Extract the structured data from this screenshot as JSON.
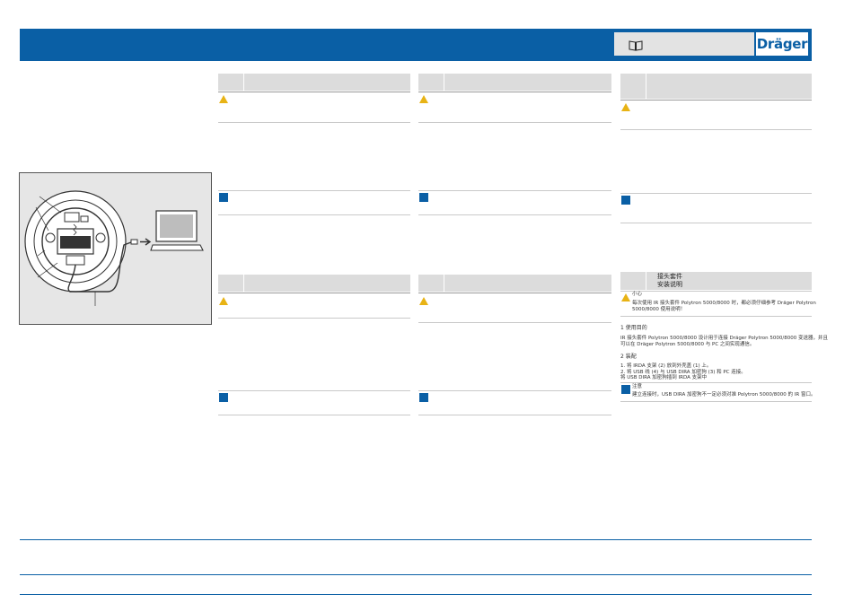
{
  "header": {
    "brand": "Dräger",
    "book_icon": "open-book-icon",
    "colors": {
      "banner": "#0a5fa5",
      "warning": "#e8b315",
      "note": "#0a5fa5",
      "header_cell": "#dcdcdc"
    }
  },
  "figure": {
    "icons": [
      "adapter-illustration",
      "usb-cable",
      "laptop-icon",
      "arrow-right-icon"
    ]
  },
  "chinese_section": {
    "title_line1": "接头套件",
    "title_line2": "安装说明",
    "caution_label": "小心",
    "caution_text_1": "每次使用 IR 接头套件 Polytron 5000/8000 时，都必须仔细参考 Dräger Polytron",
    "caution_text_2": "5000/8000 使用说明！",
    "intended_use_heading": "1    使用目的",
    "intended_use_1": "IR 接头套件 Polytron 5000/8000 设计用于连接 Dräger Polytron 5000/8000 变送器，并且",
    "intended_use_2": "可以在 Dräger Polytron 5000/8000 与 PC 之间实现通信。",
    "assembly_heading": "2    装配",
    "step1": "1.    将 IRDA 支架 (2) 放到外壳盖 (1) 上。",
    "step2a": "2.    将 USB 线 (4) 与 USB DIRA 加密狗 (3) 和 PC 连接。",
    "step2b": "       将 USB DIRA 加密狗插到 IRDA 支架中",
    "note_label": "注意",
    "note_text": "建立连接时，USB DIRA 加密狗不一定必须对准 Polytron 5000/8000 的 IR 窗口。"
  }
}
